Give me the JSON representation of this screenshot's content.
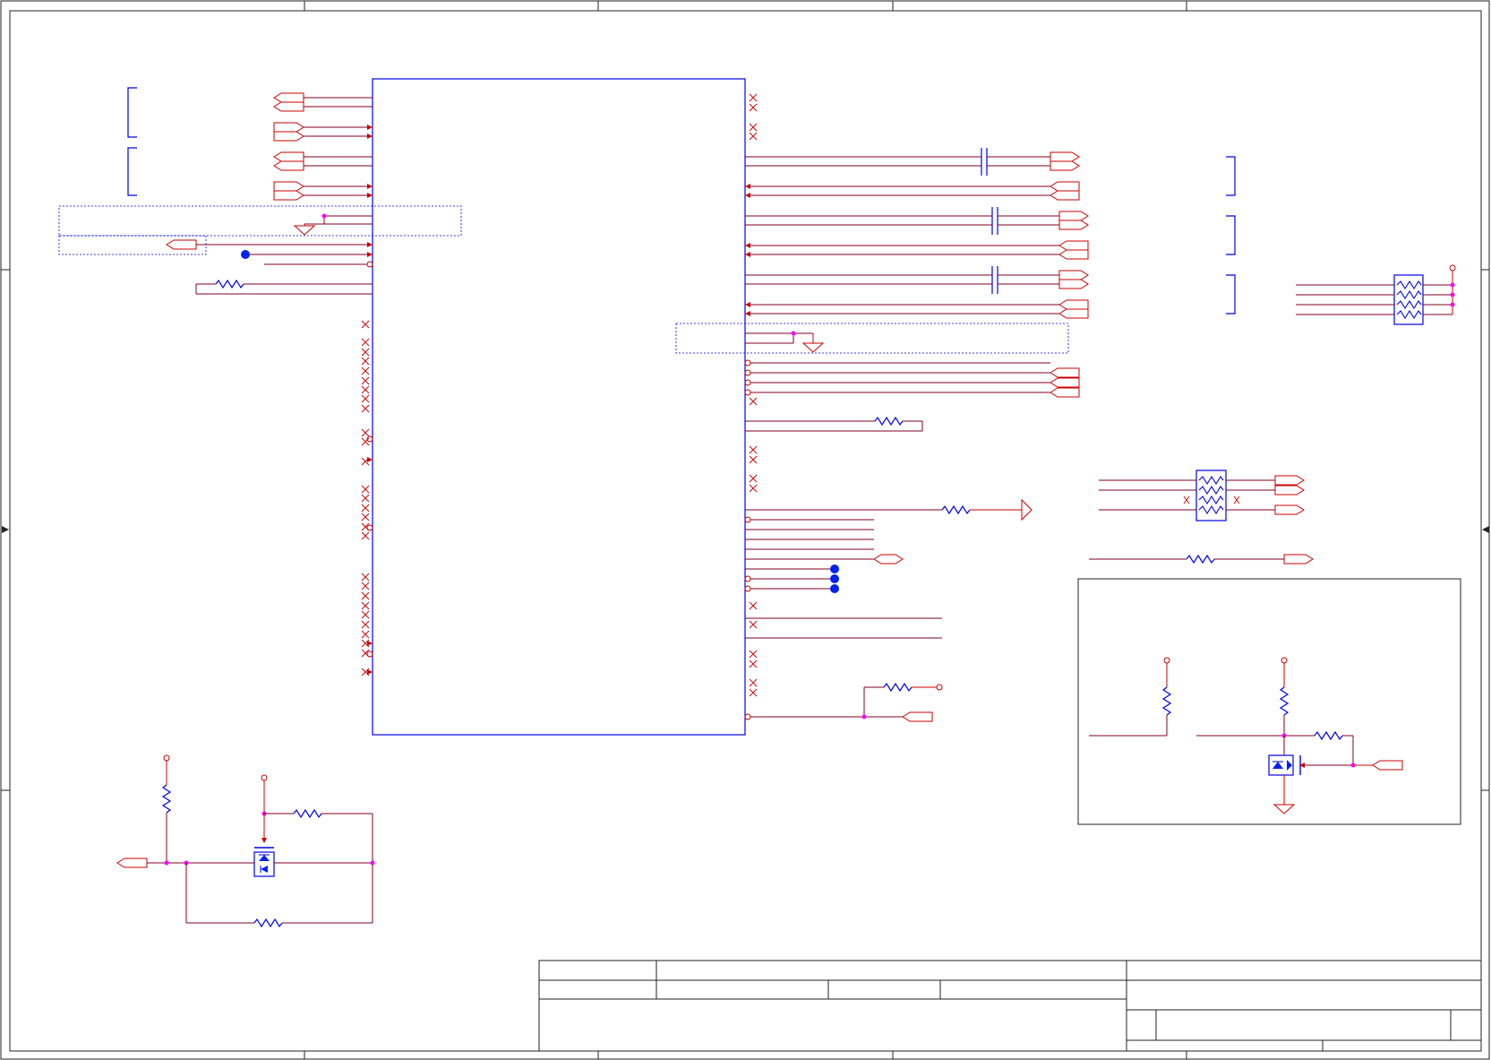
{
  "sheet": {
    "frame_color": "#222222",
    "part_color": "#0000ee",
    "wire_color": "#cc0000",
    "net_color": "#800020",
    "junction_color": "#ff00ff"
  },
  "title_block": {
    "title": "",
    "company": "",
    "document_number": "",
    "revision": "",
    "size": "",
    "date": "",
    "sheet": ""
  }
}
